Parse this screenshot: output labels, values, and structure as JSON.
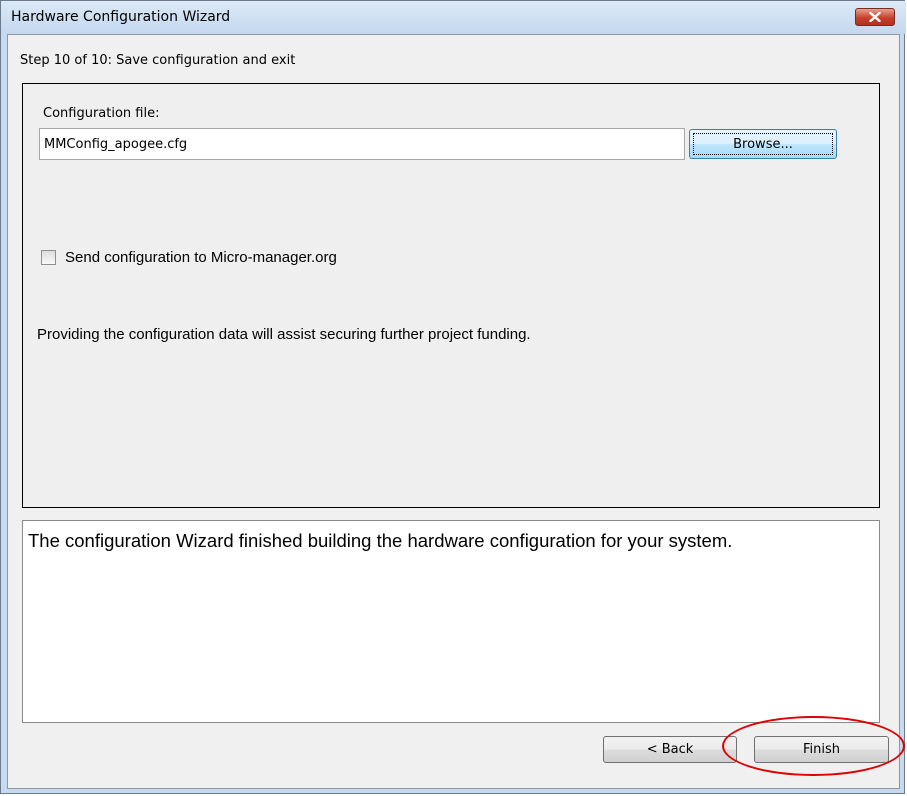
{
  "window": {
    "title": "Hardware Configuration Wizard"
  },
  "wizard": {
    "step_label": "Step 10 of 10: Save configuration and exit",
    "config_file_label": "Configuration file:",
    "config_file_value": "MMConfig_apogee.cfg",
    "browse_label": "Browse...",
    "send_config_label": "Send configuration to Micro-manager.org",
    "send_config_checked": false,
    "funding_note": "Providing the configuration data will assist securing further project funding.",
    "message": "The configuration Wizard finished building the hardware configuration for your system."
  },
  "buttons": {
    "back_label": "< Back",
    "finish_label": "Finish"
  },
  "icons": {
    "close": "close-icon"
  },
  "colors": {
    "titlebar": "#c4d8ee",
    "close_button": "#c8402c",
    "highlight_annotation": "#e00000"
  }
}
